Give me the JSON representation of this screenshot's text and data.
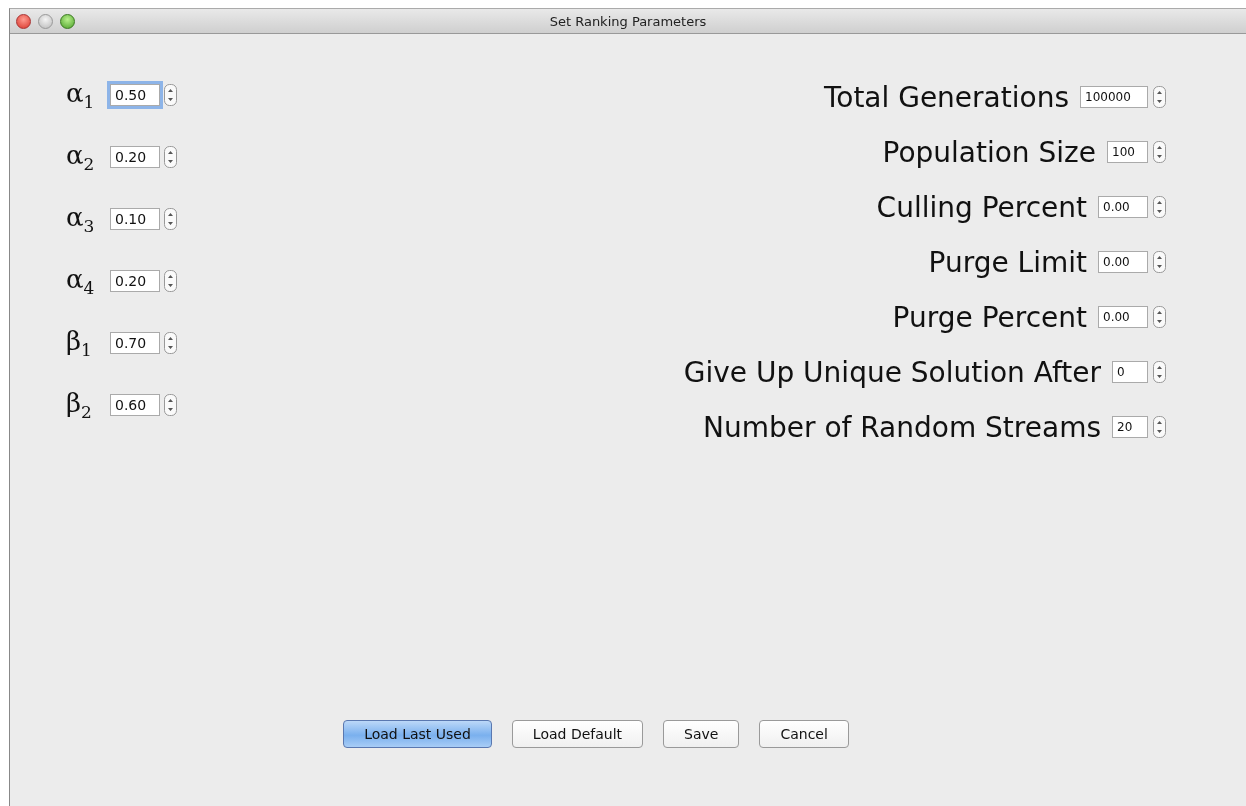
{
  "window": {
    "title": "Set Ranking Parameters"
  },
  "weights": [
    {
      "label": "α$_{1}$",
      "value": "0.50",
      "focused": true
    },
    {
      "label": "α$_{2}$",
      "value": "0.20",
      "focused": false
    },
    {
      "label": "α$_{3}$",
      "value": "0.10",
      "focused": false
    },
    {
      "label": "α$_{4}$",
      "value": "0.20",
      "focused": false
    },
    {
      "label": "β$_{1}$",
      "value": "0.70",
      "focused": false
    },
    {
      "label": "β$_{2}$",
      "value": "0.60",
      "focused": false
    }
  ],
  "settings": [
    {
      "label": "Total Generations",
      "value": "100000",
      "focused": false
    },
    {
      "label": "Population Size",
      "value": "100",
      "focused": false
    },
    {
      "label": "Culling Percent",
      "value": "0.00",
      "focused": false
    },
    {
      "label": "Purge Limit",
      "value": "0.00",
      "focused": false
    },
    {
      "label": "Purge Percent",
      "value": "0.00",
      "focused": false
    },
    {
      "label": "Give Up Unique Solution After",
      "value": "0",
      "focused": false
    },
    {
      "label": "Number of Random Streams",
      "value": "20",
      "focused": false
    }
  ],
  "buttons": [
    {
      "label": "Load Last Used",
      "default": true
    },
    {
      "label": "Load Default",
      "default": false
    },
    {
      "label": "Save",
      "default": false
    },
    {
      "label": "Cancel",
      "default": false
    }
  ]
}
